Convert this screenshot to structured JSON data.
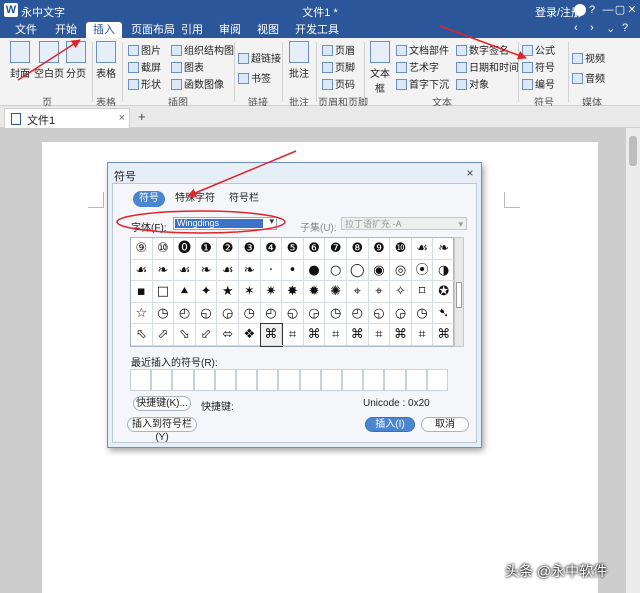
{
  "app": {
    "logo": "W",
    "name": "永中文字",
    "doc_title": "文件1 *",
    "login": "登录/注册"
  },
  "window_controls": [
    "?",
    "—",
    "▢",
    "✕"
  ],
  "menu": {
    "items": [
      "文件",
      "开始",
      "插入",
      "页面布局",
      "引用",
      "审阅",
      "视图",
      "开发工具"
    ],
    "active": "插入",
    "right_icons": [
      "‹",
      "›",
      "⌄",
      "?"
    ]
  },
  "ribbon": {
    "groups": {
      "page": {
        "label": "页",
        "buttons": [
          "封面",
          "空白页",
          "分页"
        ]
      },
      "table": {
        "label": "表格",
        "buttons": [
          "表格"
        ]
      },
      "illustration": {
        "label": "插图",
        "buttons": [
          "图片",
          "截屏",
          "形状",
          "组织结构图",
          "图表",
          "函数图像"
        ]
      },
      "link": {
        "label": "链接",
        "buttons": [
          "超链接",
          "书签"
        ]
      },
      "comment": {
        "label": "批注",
        "buttons": [
          "批注"
        ]
      },
      "header_footer": {
        "label": "页眉和页脚",
        "buttons": [
          "页眉",
          "页脚",
          "页码"
        ]
      },
      "text": {
        "label": "文本",
        "buttons": [
          "文本框",
          "文档部件",
          "艺术字",
          "首字下沉",
          "数字签名",
          "日期和时间",
          "对象"
        ]
      },
      "symbol": {
        "label": "符号",
        "buttons": [
          "公式",
          "符号",
          "编号"
        ]
      },
      "media": {
        "label": "媒体",
        "buttons": [
          "视频",
          "音频"
        ]
      }
    }
  },
  "tabs": {
    "doc_tab": "文件1",
    "add": "+"
  },
  "dialog": {
    "title": "符号",
    "tabs": [
      "符号",
      "特殊字符",
      "符号栏"
    ],
    "active_tab": "符号",
    "font_label": "字体(F):",
    "font_value": "Wingdings",
    "subset_label": "子集(U):",
    "subset_value": "拉丁语扩充 -A",
    "symbols": [
      "⑨",
      "⑩",
      "⓿",
      "❶",
      "❷",
      "❸",
      "❹",
      "❺",
      "❻",
      "❼",
      "❽",
      "❾",
      "❿",
      "☙",
      "❧",
      "☙",
      "❧",
      "☙",
      "❧",
      "☙",
      "❧",
      "·",
      "•",
      "●",
      "○",
      "◯",
      "◉",
      "◎",
      "⦿",
      "◑",
      "▪",
      "□",
      "⯅",
      "✦",
      "★",
      "✶",
      "✷",
      "✸",
      "✹",
      "✺",
      "⌖",
      "⌖",
      "✧",
      "⌑",
      "✪",
      "☆",
      "◷",
      "◴",
      "◵",
      "◶",
      "◷",
      "◴",
      "◵",
      "◶",
      "◷",
      "◴",
      "◵",
      "◶",
      "◷",
      "➷",
      "⬁",
      "⬀",
      "⬂",
      "⬃",
      "⬄",
      "❖",
      "⌘",
      "⌗",
      "⌘",
      "⌗",
      "⌘",
      "⌗",
      "⌘",
      "⌗",
      "⌘"
    ],
    "selected_index": 66,
    "recent_label": "最近插入的符号(R):",
    "shortcut_button": "快捷键(K)...",
    "shortcut_label": "快捷键:",
    "unicode_label": "Unicode : 0x20",
    "insert_bar_button": "插入到符号栏(Y)",
    "insert_button": "插入(I)",
    "cancel_button": "取消"
  },
  "watermark": "头条 @永中软件",
  "colors": {
    "title_bar": "#2b579a",
    "annotation": "#e0242b",
    "accent": "#4a86d0"
  },
  "icons": [
    "app-logo-icon",
    "user-icon",
    "document-icon",
    "close-icon",
    "plus-icon"
  ]
}
